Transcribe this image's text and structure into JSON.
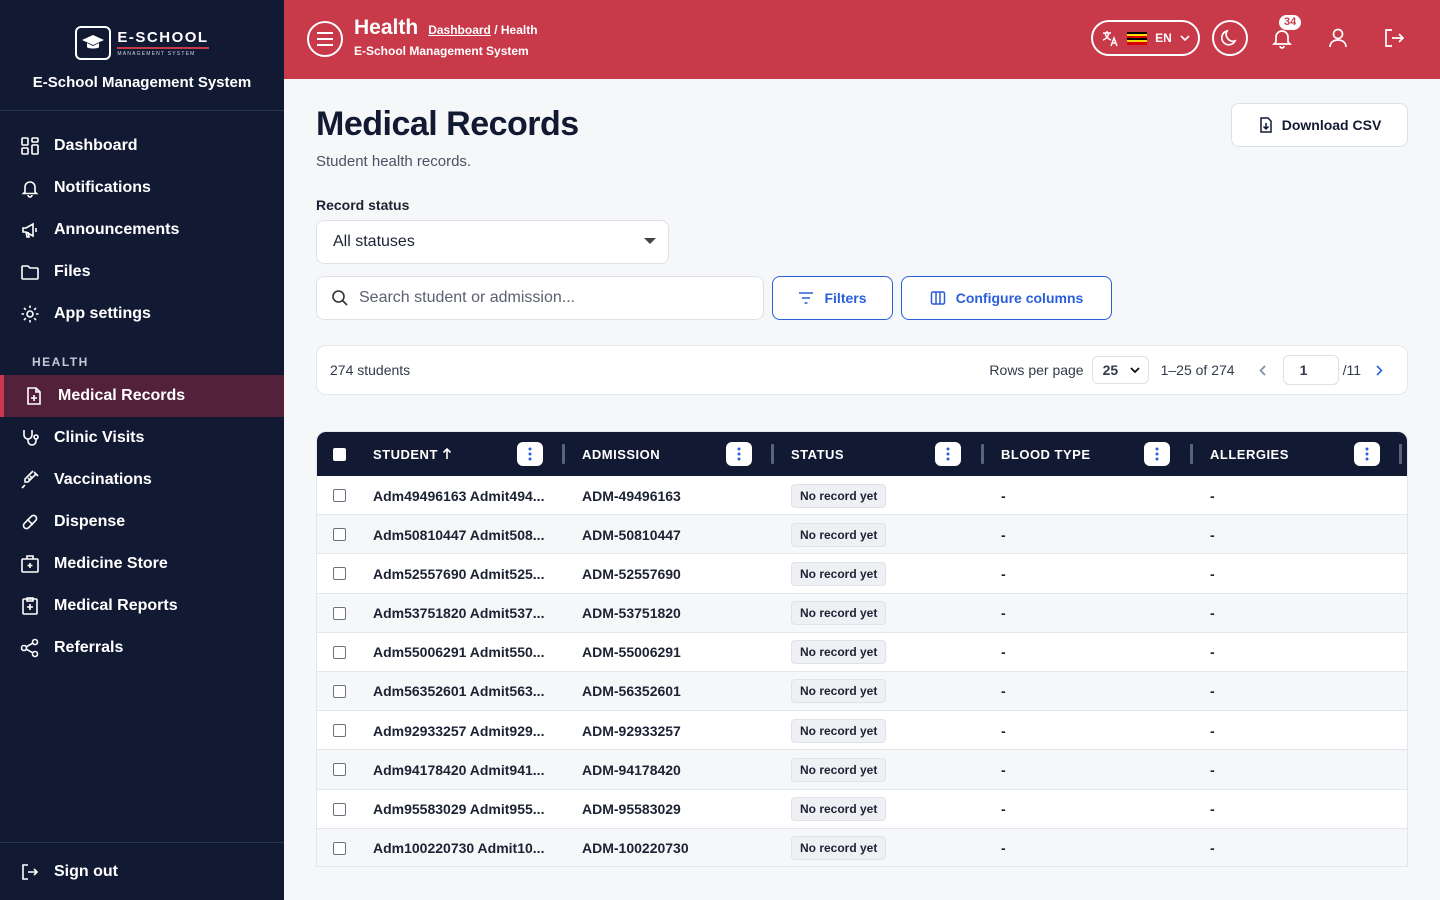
{
  "sidebar": {
    "logo_main": "E-SCHOOL",
    "logo_sub": "MANAGEMENT SYSTEM",
    "brand_name": "E-School Management System",
    "items": [
      {
        "label": "Dashboard",
        "icon": "dashboard-icon"
      },
      {
        "label": "Notifications",
        "icon": "bell-icon"
      },
      {
        "label": "Announcements",
        "icon": "megaphone-icon"
      },
      {
        "label": "Files",
        "icon": "folder-icon"
      },
      {
        "label": "App settings",
        "icon": "gear-icon"
      }
    ],
    "section": "HEALTH",
    "health_items": [
      {
        "label": "Medical Records",
        "icon": "medical-file-icon",
        "active": true
      },
      {
        "label": "Clinic Visits",
        "icon": "stethoscope-icon"
      },
      {
        "label": "Vaccinations",
        "icon": "syringe-icon"
      },
      {
        "label": "Dispense",
        "icon": "pill-icon"
      },
      {
        "label": "Medicine Store",
        "icon": "store-icon"
      },
      {
        "label": "Medical Reports",
        "icon": "report-icon"
      },
      {
        "label": "Referrals",
        "icon": "share-icon"
      }
    ],
    "signout": "Sign out"
  },
  "header": {
    "title": "Health",
    "crumb_link": "Dashboard",
    "crumb_sep": " / ",
    "crumb_current": "Health",
    "subtitle": "E-School Management System",
    "lang": "EN",
    "notif_count": "34",
    "accent": "#c8394a"
  },
  "main": {
    "title": "Medical Records",
    "subtitle": "Student health records.",
    "csv_label": "Download CSV",
    "status_label": "Record status",
    "status_value": "All statuses",
    "search_placeholder": "Search student or admission...",
    "filters_label": "Filters",
    "configure_label": "Configure columns"
  },
  "pager": {
    "count": "274 students",
    "rows_label": "Rows per page",
    "rows_value": "25",
    "range": "1–25 of 274",
    "page": "1",
    "total": "/11"
  },
  "table": {
    "columns": [
      "STUDENT",
      "ADMISSION",
      "STATUS",
      "BLOOD TYPE",
      "ALLERGIES"
    ],
    "rows": [
      {
        "student": "Adm49496163 Admit494...",
        "admission": "ADM-49496163",
        "status": "No record yet",
        "blood": "-",
        "allergies": "-"
      },
      {
        "student": "Adm50810447 Admit508...",
        "admission": "ADM-50810447",
        "status": "No record yet",
        "blood": "-",
        "allergies": "-"
      },
      {
        "student": "Adm52557690 Admit525...",
        "admission": "ADM-52557690",
        "status": "No record yet",
        "blood": "-",
        "allergies": "-"
      },
      {
        "student": "Adm53751820 Admit537...",
        "admission": "ADM-53751820",
        "status": "No record yet",
        "blood": "-",
        "allergies": "-"
      },
      {
        "student": "Adm55006291 Admit550...",
        "admission": "ADM-55006291",
        "status": "No record yet",
        "blood": "-",
        "allergies": "-"
      },
      {
        "student": "Adm56352601 Admit563...",
        "admission": "ADM-56352601",
        "status": "No record yet",
        "blood": "-",
        "allergies": "-"
      },
      {
        "student": "Adm92933257 Admit929...",
        "admission": "ADM-92933257",
        "status": "No record yet",
        "blood": "-",
        "allergies": "-"
      },
      {
        "student": "Adm94178420 Admit941...",
        "admission": "ADM-94178420",
        "status": "No record yet",
        "blood": "-",
        "allergies": "-"
      },
      {
        "student": "Adm95583029 Admit955...",
        "admission": "ADM-95583029",
        "status": "No record yet",
        "blood": "-",
        "allergies": "-"
      },
      {
        "student": "Adm100220730 Admit10...",
        "admission": "ADM-100220730",
        "status": "No record yet",
        "blood": "-",
        "allergies": "-"
      }
    ]
  }
}
